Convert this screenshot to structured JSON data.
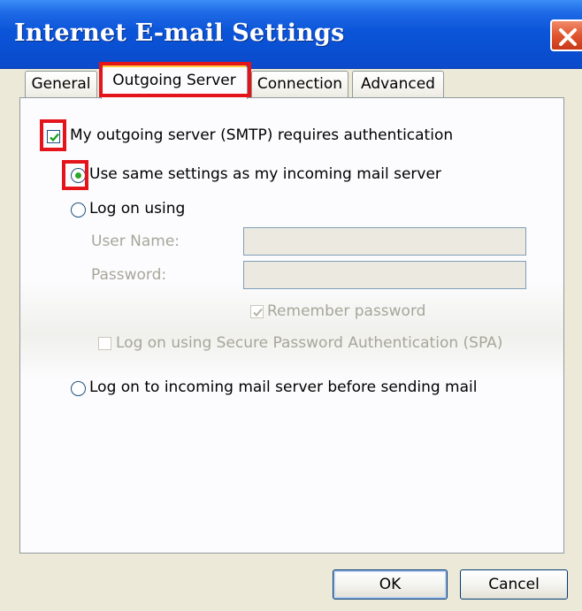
{
  "window": {
    "title": "Internet E-mail Settings"
  },
  "tabs": [
    {
      "label": "General",
      "active": false
    },
    {
      "label": "Outgoing Server",
      "active": true
    },
    {
      "label": "Connection",
      "active": false
    },
    {
      "label": "Advanced",
      "active": false
    }
  ],
  "smtp_auth": {
    "label": "My outgoing server (SMTP) requires authentication",
    "checked": true
  },
  "options": {
    "same_settings_label": "Use same settings as my incoming mail server",
    "log_on_using_label": "Log on using",
    "user_name_label": "User Name:",
    "user_name_value": "",
    "password_label": "Password:",
    "password_value": "",
    "remember_password_label": "Remember password",
    "remember_password_checked": true,
    "spa_label": "Log on using Secure Password Authentication (SPA)",
    "spa_checked": false,
    "log_on_incoming_label": "Log on to incoming mail server before sending mail"
  },
  "buttons": {
    "ok": "OK",
    "cancel": "Cancel"
  },
  "colors": {
    "highlight": "#E4141B",
    "titlebar": "#0B55D9",
    "radio_selected": "#2BA82B"
  }
}
